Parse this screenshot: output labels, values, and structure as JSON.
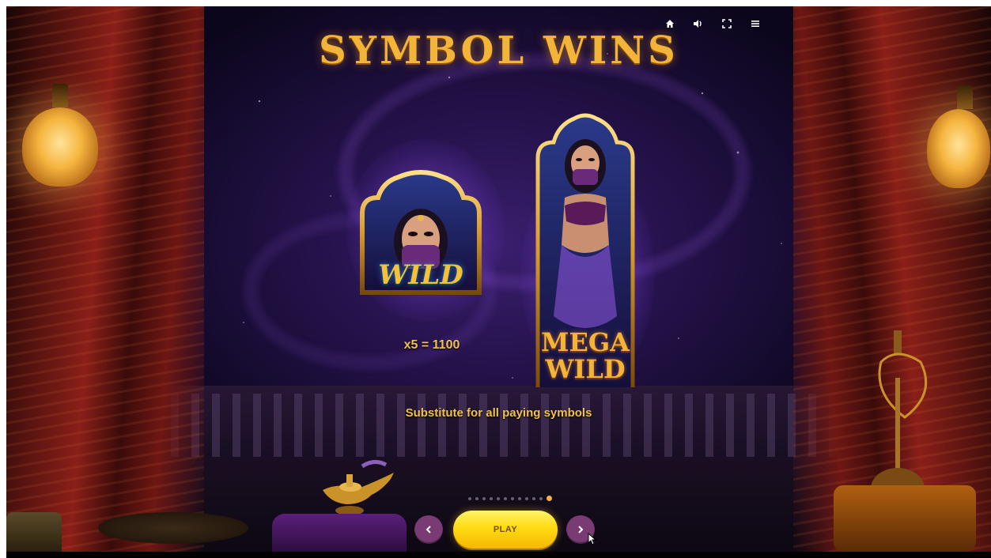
{
  "game": {
    "title": "SYMBOL WINS",
    "wild_symbol": {
      "icon": "wild-symbol",
      "label": "WILD",
      "payout": "x5 = 1100"
    },
    "mega_wild_symbol": {
      "icon": "mega-wild-symbol",
      "label_line1": "MEGA",
      "label_line2": "WILD"
    },
    "description": "Substitute for all paying symbols"
  },
  "top_bar": {
    "icons": [
      "home-icon",
      "sound-icon",
      "fullscreen-icon",
      "menu-icon"
    ]
  },
  "pagination": {
    "total": 12,
    "current": 12
  },
  "controls": {
    "prev_icon": "chevron-left-icon",
    "play_label": "PLAY",
    "next_icon": "chevron-right-icon"
  },
  "colors": {
    "title_gold": "#f3b43a",
    "text_gold": "#f0c24a",
    "play_yellow": "#ffdb12",
    "nav_purple": "#7a3a74",
    "background_purple": "#24124a"
  }
}
